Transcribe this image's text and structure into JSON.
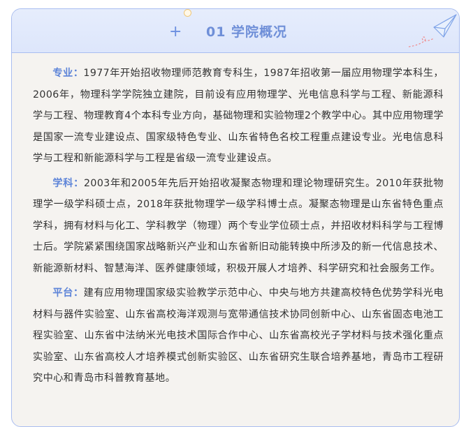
{
  "header": {
    "title": "01 学院概况",
    "plus_glyph": "+"
  },
  "paragraphs": [
    {
      "label": "专业：",
      "text": "1977年开始招收物理师范教育专科生，1987年招收第一届应用物理学本科生，2006年，物理科学学院独立建院，目前设有应用物理学、光电信息科学与工程、新能源科学与工程、物理教育4个本科专业方向，基础物理和实验物理2个教学中心。其中应用物理学是国家一流专业建设点、国家级特色专业、山东省特色名校工程重点建设专业。光电信息科学与工程和新能源科学与工程是省级一流专业建设点。"
    },
    {
      "label": "学科：",
      "text": "2003年和2005年先后开始招收凝聚态物理和理论物理研究生。2010年获批物理学一级学科硕士点，2018年获批物理学一级学科博士点。凝聚态物理是山东省特色重点学科，拥有材料与化工、学科教学（物理）两个专业学位硕士点，并招收材料科学与工程博士后。学院紧紧围绕国家战略新兴产业和山东省新旧动能转换中所涉及的新一代信息技术、新能源新材料、智慧海洋、医养健康领域，积极开展人才培养、科学研究和社会服务工作。"
    },
    {
      "label": "平台：",
      "text": "建有应用物理国家级实验教学示范中心、中央与地方共建高校特色优势学科光电材料与器件实验室、山东省高校海洋观测与宽带通信技术协同创新中心、山东省固态电池工程实验室、山东省中法纳米光电技术国际合作中心、山东省高校光子学材料与技术强化重点实验室、山东省高校人才培养模式创新实验区、山东省研究生联合培养基地，青岛市工程研究中心和青岛市科普教育基地。"
    }
  ],
  "colors": {
    "accent": "#5d84d8",
    "title": "#6f8fd8",
    "border": "#a9bdf0",
    "background": "#f5f3f0",
    "text": "#333333"
  },
  "icons": [
    "paper-plane-icon",
    "circle-decoration-icon",
    "plus-icon"
  ]
}
